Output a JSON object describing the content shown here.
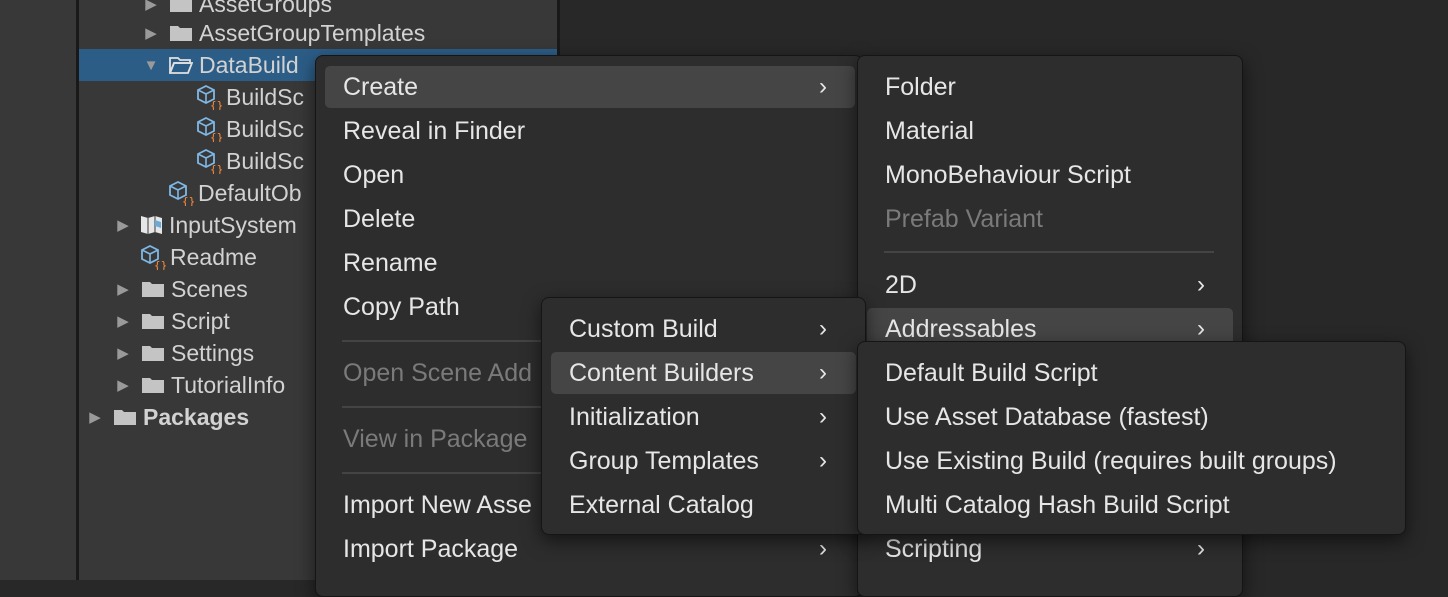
{
  "project_tree": {
    "rows": [
      {
        "label": "AssetGroups",
        "icon": "folder-icon"
      },
      {
        "label": "AssetGroupTemplates",
        "icon": "folder-icon"
      },
      {
        "label": "DataBuild",
        "icon": "folder-open-icon"
      },
      {
        "label": "BuildSc",
        "icon": "scriptable-object-icon"
      },
      {
        "label": "BuildSc",
        "icon": "scriptable-object-icon"
      },
      {
        "label": "BuildSc",
        "icon": "scriptable-object-icon"
      },
      {
        "label": "DefaultOb",
        "icon": "scriptable-object-icon"
      },
      {
        "label": "InputSystem",
        "icon": "input-actions-icon"
      },
      {
        "label": "Readme",
        "icon": "scriptable-object-icon"
      },
      {
        "label": "Scenes",
        "icon": "folder-icon"
      },
      {
        "label": "Script",
        "icon": "folder-icon"
      },
      {
        "label": "Settings",
        "icon": "folder-icon"
      },
      {
        "label": "TutorialInfo",
        "icon": "folder-icon"
      },
      {
        "label": "Packages",
        "icon": "folder-icon"
      }
    ]
  },
  "context_menu": {
    "items": [
      {
        "label": "Create",
        "submenu": true,
        "highlighted": true
      },
      {
        "label": "Reveal in Finder"
      },
      {
        "label": "Open"
      },
      {
        "label": "Delete"
      },
      {
        "label": "Rename"
      },
      {
        "label": "Copy Path"
      },
      {
        "label": "Open Scene Add",
        "disabled": true
      },
      {
        "label": "View in Package",
        "disabled": true
      },
      {
        "label": "Import New Asse"
      },
      {
        "label": "Import Package",
        "submenu": true
      }
    ]
  },
  "create_menu": {
    "items": [
      {
        "label": "Folder"
      },
      {
        "label": "Material"
      },
      {
        "label": "MonoBehaviour Script"
      },
      {
        "label": "Prefab Variant",
        "disabled": true
      },
      {
        "label": "2D",
        "submenu": true
      },
      {
        "label": "Addressables",
        "submenu": true,
        "highlighted": true
      },
      {
        "label": "Scripting",
        "submenu": true
      }
    ]
  },
  "addressables_menu": {
    "items": [
      {
        "label": "Custom Build",
        "submenu": true
      },
      {
        "label": "Content Builders",
        "submenu": true,
        "highlighted": true
      },
      {
        "label": "Initialization",
        "submenu": true
      },
      {
        "label": "Group Templates",
        "submenu": true
      },
      {
        "label": "External Catalog"
      }
    ]
  },
  "content_builders_menu": {
    "items": [
      {
        "label": "Default Build Script"
      },
      {
        "label": "Use Asset Database (fastest)"
      },
      {
        "label": "Use Existing Build (requires built groups)"
      },
      {
        "label": "Multi Catalog Hash Build Script"
      }
    ]
  },
  "icons": {
    "chevron": "›",
    "submenu_arrow": "chevron-right-icon"
  },
  "colors": {
    "selection": "#2c5d87",
    "menu_bg": "#2d2d2d",
    "highlight": "#454545",
    "script_accent": "#ff8c3a",
    "cube_accent": "#7fb8e6"
  }
}
